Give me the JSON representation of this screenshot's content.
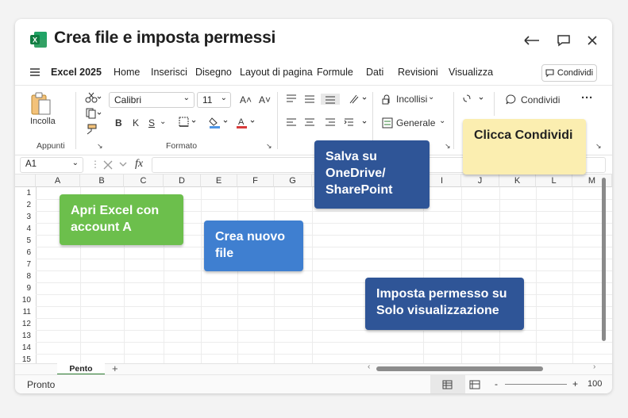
{
  "window": {
    "title": "Crea file e imposta permessi",
    "controls": [
      "back-icon",
      "comment-icon",
      "close-icon"
    ]
  },
  "menubar": {
    "menu_icon": "hamburger-icon",
    "items": [
      {
        "label": "Excel 2025",
        "active": true
      },
      {
        "label": "Home"
      },
      {
        "label": "Inserisci"
      },
      {
        "label": "Disegno"
      },
      {
        "label": "Layout di pagina"
      },
      {
        "label": "Formule"
      },
      {
        "label": "Dati"
      },
      {
        "label": "Revisioni"
      },
      {
        "label": "Visualizza"
      }
    ],
    "share_label": "Condividi"
  },
  "ribbon": {
    "paste_label": "Incolla",
    "clipboard_group": "Appunti",
    "font_name": "Calibri",
    "font_size": "11",
    "grow_font": "A˄",
    "shrink_font": "A˅",
    "bold": "B",
    "italic": "K",
    "underline": "S",
    "format_group": "Formato",
    "paste_menu_label": "Incollisi",
    "number_format": "Generale",
    "share_label": "Condividi",
    "more": "···"
  },
  "formulabar": {
    "cell_ref": "A1",
    "fx": "fx"
  },
  "grid": {
    "columns": [
      "A",
      "B",
      "C",
      "D",
      "E",
      "F",
      "G",
      "H",
      "I",
      "J",
      "K",
      "L",
      "M"
    ],
    "rows": [
      "1",
      "2",
      "3",
      "4",
      "5",
      "6",
      "7",
      "8",
      "9",
      "10",
      "11",
      "12",
      "13",
      "14",
      "15"
    ]
  },
  "sheet": {
    "tab_label": "Pento",
    "add_icon": "+"
  },
  "status": {
    "text": "Pronto",
    "zoom": "100",
    "zoom_minus": "-",
    "zoom_plus": "+"
  },
  "callouts": {
    "open_excel": "Apri Excel con account A",
    "new_file": "Crea nuovo file",
    "save": "Salva su OneDrive/ SharePoint",
    "click_share": "Clicca Condividi",
    "permission": "Imposta permesso su Solo visualizzazione"
  },
  "colors": {
    "excel_green": "#1e7145",
    "callout_green": "#6cbf4c",
    "callout_blue": "#3f7fd0",
    "callout_navy": "#2f5597",
    "callout_yellow": "#fbeeb0"
  }
}
